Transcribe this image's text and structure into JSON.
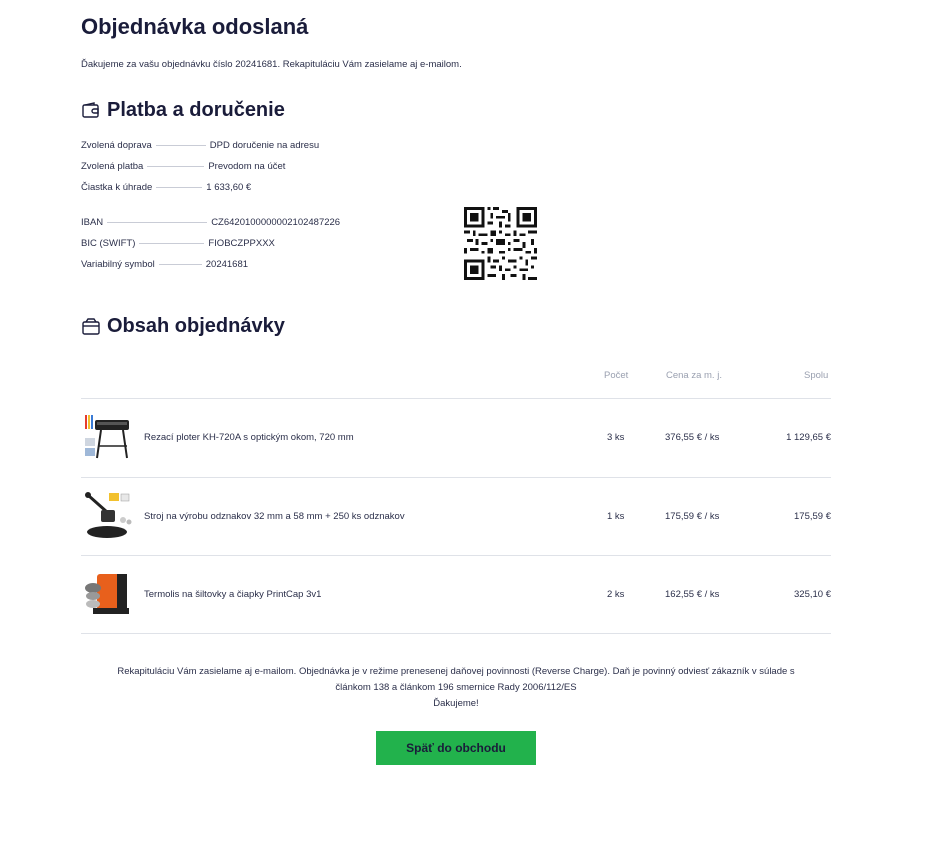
{
  "page": {
    "title": "Objednávka odoslaná",
    "intro": "Ďakujeme za vašu objednávku číslo 20241681. Rekapituláciu Vám zasielame aj e-mailom."
  },
  "payment": {
    "title": "Platba a doručenie",
    "icon": "wallet-icon",
    "rows": [
      {
        "label": "Zvolená doprava",
        "value": "DPD doručenie na adresu"
      },
      {
        "label": "Zvolená platba",
        "value": "Prevodom na účet"
      },
      {
        "label": "Čiastka k úhrade",
        "value": "1 633,60 €"
      }
    ],
    "bank": [
      {
        "label": "IBAN",
        "value": "CZ6420100000002102487226"
      },
      {
        "label": "BIC (SWIFT)",
        "value": "FIOBCZPPXXX"
      },
      {
        "label": "Variabilný symbol",
        "value": "20241681"
      }
    ]
  },
  "order": {
    "title": "Obsah objednávky",
    "icon": "box-icon",
    "columns": {
      "qty": "Počet",
      "unit_price": "Cena za m. j.",
      "total": "Spolu"
    },
    "items": [
      {
        "name": "Rezací ploter KH-720A s optickým okom, 720 mm",
        "qty": "3 ks",
        "unit_price": "376,55 € / ks",
        "total": "1 129,65 €"
      },
      {
        "name": "Stroj na výrobu odznakov 32 mm a 58 mm + 250 ks odznakov",
        "qty": "1 ks",
        "unit_price": "175,59 € / ks",
        "total": "175,59 €"
      },
      {
        "name": "Termolis na šiltovky a čiapky PrintCap 3v1",
        "qty": "2 ks",
        "unit_price": "162,55 € / ks",
        "total": "325,10 €"
      }
    ]
  },
  "footer": {
    "line1": "Rekapituláciu Vám zasielame aj e-mailom. Objednávka je v režime prenesenej daňovej povinnosti (Reverse Charge). Daň je povinný odviesť zákazník v súlade s",
    "line2": "článkom 138 a článkom 196 smernice Rady 2006/112/ES",
    "line3": "Ďakujeme!"
  },
  "button": {
    "label": "Späť do obchodu",
    "color": "#22b24c"
  }
}
